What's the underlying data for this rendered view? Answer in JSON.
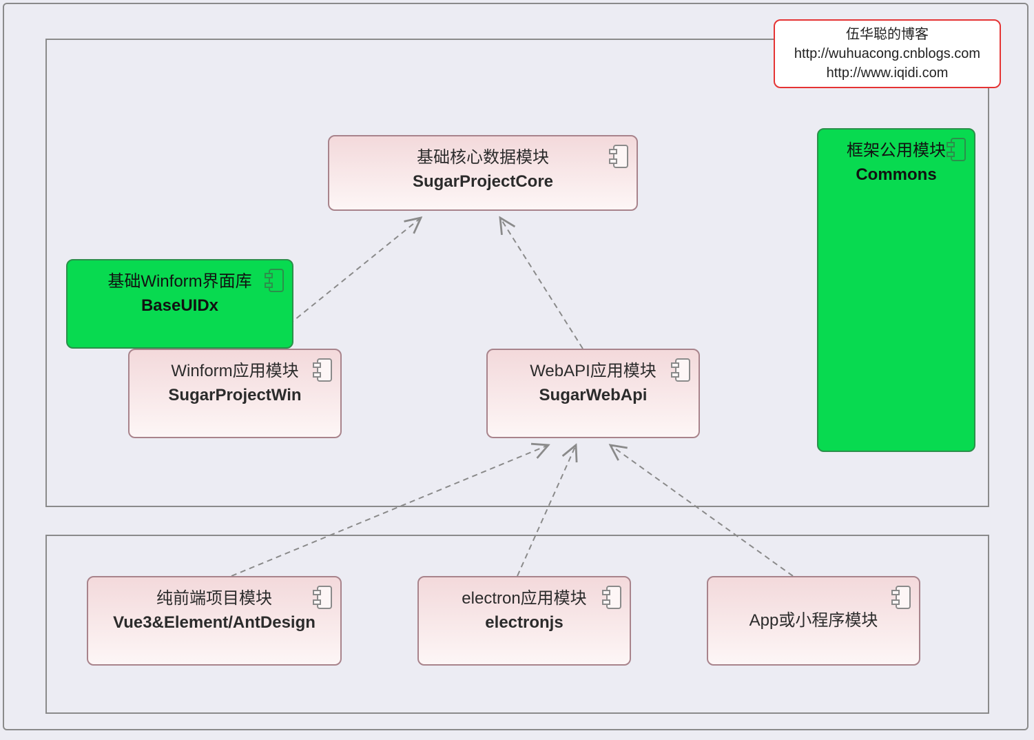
{
  "watermark": {
    "title": "伍华聪的博客",
    "url1": "http://wuhuacong.cnblogs.com",
    "url2": "http://www.iqidi.com"
  },
  "nodes": {
    "core": {
      "line1": "基础核心数据模块",
      "line2": "SugarProjectCore"
    },
    "commons": {
      "line1": "框架公用模块",
      "line2": "Commons"
    },
    "basedx": {
      "line1": "基础Winform界面库",
      "line2": "BaseUIDx"
    },
    "win": {
      "line1": "Winform应用模块",
      "line2": "SugarProjectWin"
    },
    "webapi": {
      "line1": "WebAPI应用模块",
      "line2": "SugarWebApi"
    },
    "vue": {
      "line1": "纯前端项目模块",
      "line2": "Vue3&Element/AntDesign"
    },
    "electron": {
      "line1": "electron应用模块",
      "line2": "electronjs"
    },
    "app": {
      "line1": "App或小程序模块",
      "line2": ""
    }
  },
  "edges": [
    {
      "from": "win",
      "to": "core"
    },
    {
      "from": "webapi",
      "to": "core"
    },
    {
      "from": "vue",
      "to": "webapi"
    },
    {
      "from": "electron",
      "to": "webapi"
    },
    {
      "from": "app",
      "to": "webapi"
    }
  ],
  "colors": {
    "pink_border": "#a8838b",
    "pink_fill_top": "#f3d9db",
    "pink_fill_bottom": "#fdf6f6",
    "green_fill": "#08da50",
    "frame_border": "#8a8a8a",
    "watermark_border": "#e53333",
    "bg": "#ececf3"
  }
}
